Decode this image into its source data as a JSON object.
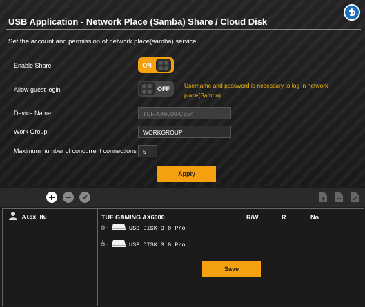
{
  "page": {
    "title": "USB Application - Network Place (Samba) Share / Cloud Disk",
    "description": "Set the account and permission of network place(samba) service."
  },
  "form": {
    "enable_share": {
      "label": "Enable Share",
      "state": "ON"
    },
    "allow_guest": {
      "label": "Allow guest login",
      "state": "OFF"
    },
    "guest_warning": "Username and password is necessary to log in network place(Samba)",
    "device_name": {
      "label": "Device Name",
      "value": "TUF-AX6000-CE54"
    },
    "work_group": {
      "label": "Work Group",
      "value": "WORKGROUP"
    },
    "max_connections": {
      "label": "Maximum number of concurrent connections",
      "value": "5"
    },
    "apply_label": "Apply"
  },
  "toolbar": {
    "icons": [
      "add-user-icon",
      "remove-user-icon",
      "edit-user-icon",
      "add-folder-icon",
      "delete-folder-icon",
      "modify-folder-icon"
    ]
  },
  "accounts": {
    "users": [
      {
        "name": "Alex_Hu"
      }
    ]
  },
  "permissions": {
    "device": "TUF GAMING AX6000",
    "columns": [
      "R/W",
      "R",
      "No"
    ],
    "disks": [
      {
        "name": "USB DISK 3.0 Pro"
      },
      {
        "name": "USB DISK 3.0 Pro"
      }
    ],
    "save_label": "Save"
  },
  "colors": {
    "accent": "#f5a00f",
    "warning_text": "#f5b80f",
    "background": "#1c1c1c"
  }
}
